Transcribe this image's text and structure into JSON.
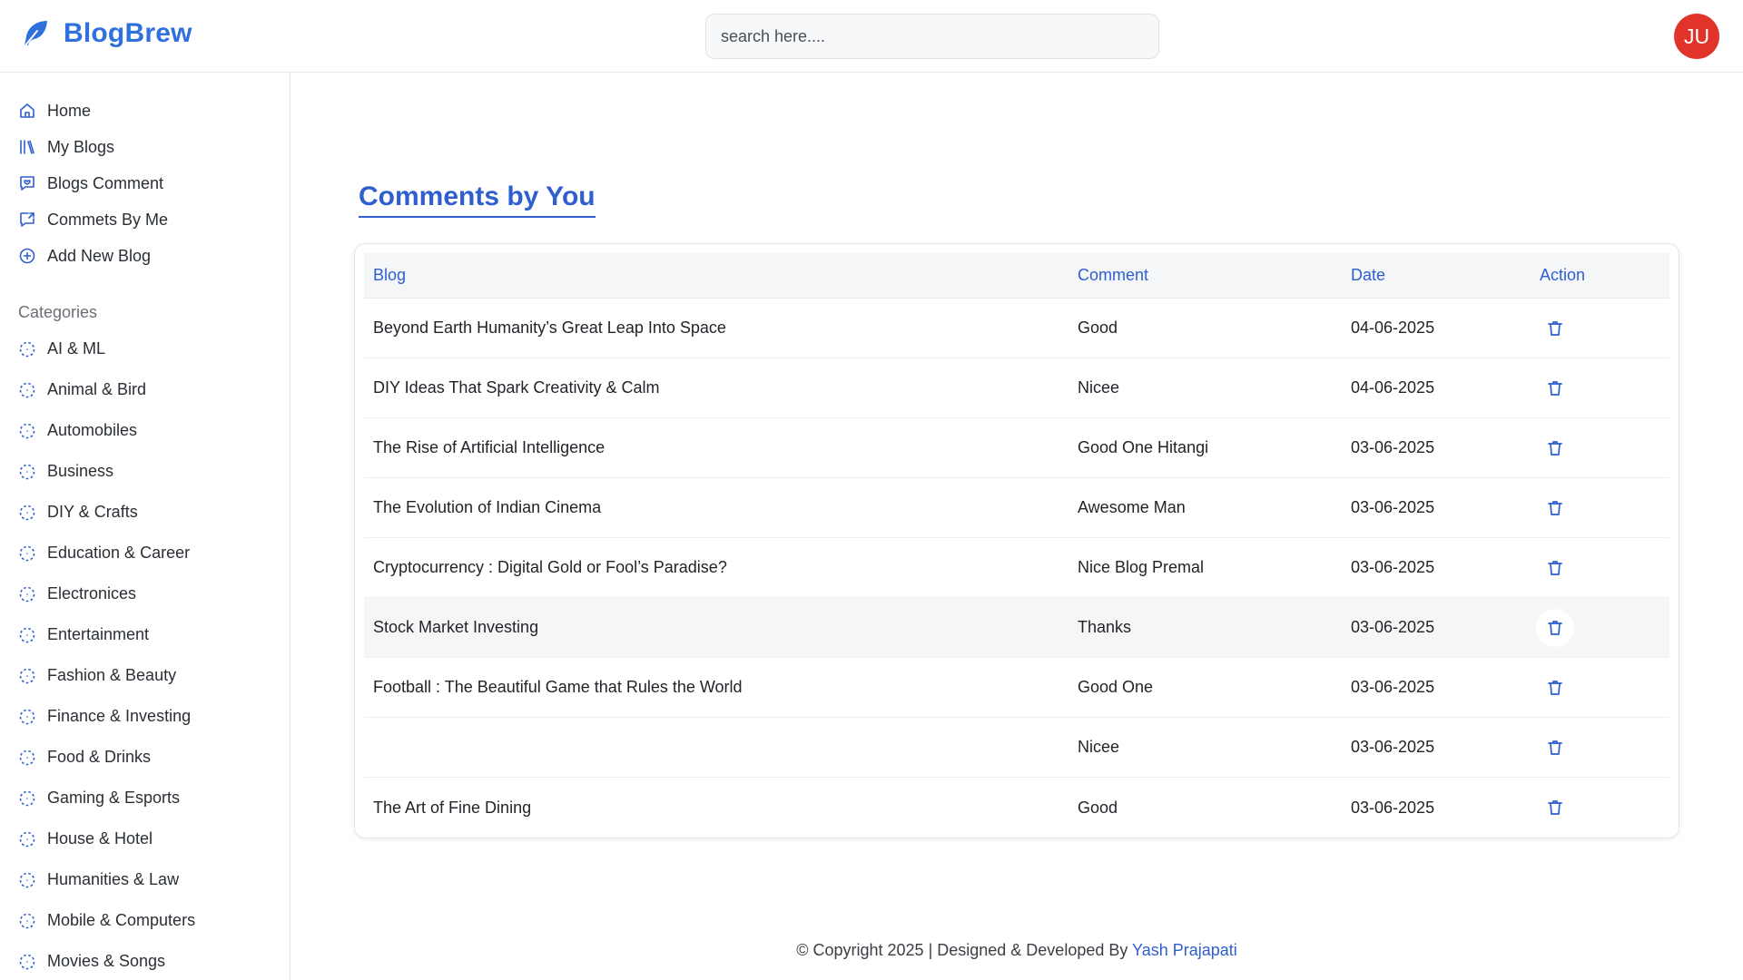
{
  "header": {
    "brand": "BlogBrew",
    "search_placeholder": "search here....",
    "avatar_initials": "JU"
  },
  "sidebar": {
    "nav": [
      {
        "label": "Home",
        "icon": "home-icon"
      },
      {
        "label": "My Blogs",
        "icon": "library-icon"
      },
      {
        "label": "Blogs Comment",
        "icon": "message-square-icon"
      },
      {
        "label": "Commets By Me",
        "icon": "message-share-icon"
      },
      {
        "label": "Add New Blog",
        "icon": "plus-circle-icon"
      }
    ],
    "categories_title": "Categories",
    "categories": [
      "AI & ML",
      "Animal & Bird",
      "Automobiles",
      "Business",
      "DIY & Crafts",
      "Education & Career",
      "Electronices",
      "Entertainment",
      "Fashion & Beauty",
      "Finance & Investing",
      "Food & Drinks",
      "Gaming & Esports",
      "House & Hotel",
      "Humanities & Law",
      "Mobile & Computers",
      "Movies & Songs"
    ]
  },
  "main": {
    "title": "Comments by You",
    "columns": [
      "Blog",
      "Comment",
      "Date",
      "Action"
    ],
    "rows": [
      {
        "blog": "Beyond Earth Humanity’s Great Leap Into Space",
        "comment": "Good",
        "date": "04-06-2025"
      },
      {
        "blog": "DIY Ideas That Spark Creativity & Calm",
        "comment": "Nicee",
        "date": "04-06-2025"
      },
      {
        "blog": "The Rise of Artificial Intelligence",
        "comment": "Good One Hitangi",
        "date": "03-06-2025"
      },
      {
        "blog": "The Evolution of Indian Cinema",
        "comment": "Awesome Man",
        "date": "03-06-2025"
      },
      {
        "blog": "Cryptocurrency : Digital Gold or Fool’s Paradise?",
        "comment": "Nice Blog Premal",
        "date": "03-06-2025"
      },
      {
        "blog": "Stock Market Investing",
        "comment": "Thanks",
        "date": "03-06-2025"
      },
      {
        "blog": "Football : The Beautiful Game that Rules the World",
        "comment": "Good One",
        "date": "03-06-2025"
      },
      {
        "blog": "",
        "comment": "Nicee",
        "date": "03-06-2025"
      },
      {
        "blog": "The Art of Fine Dining",
        "comment": "Good",
        "date": "03-06-2025"
      }
    ],
    "action_icon": "trash-icon"
  },
  "footer": {
    "text": "© Copyright 2025 | Designed & Developed By ",
    "author": "Yash Prajapati"
  },
  "colors": {
    "brand": "#2f6fde",
    "accent": "#2f5fcf",
    "avatar_bg": "#e0342b"
  }
}
